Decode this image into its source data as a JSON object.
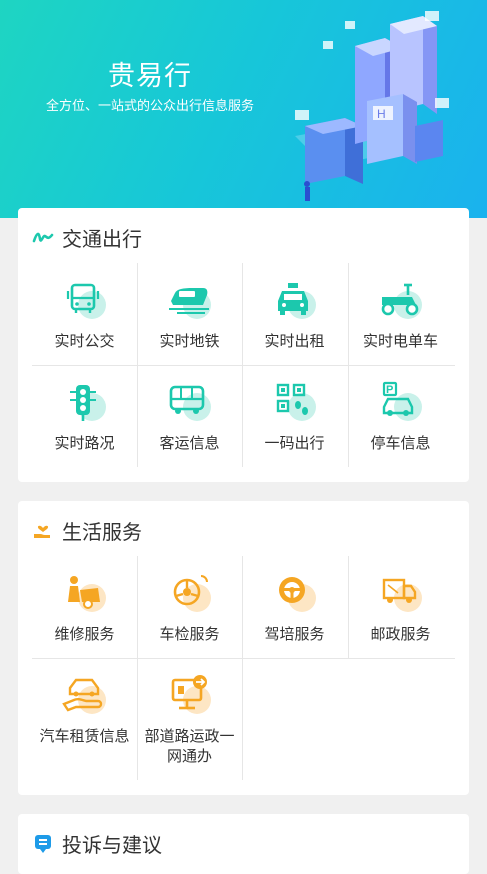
{
  "header": {
    "title": "贵易行",
    "subtitle": "全方位、一站式的公众出行信息服务"
  },
  "colors": {
    "teal": "#1cc8ad",
    "orange": "#f5a623",
    "blue": "#1e9be8"
  },
  "sections": {
    "traffic": {
      "title": "交通出行",
      "icon": "wave-icon",
      "items": [
        {
          "label": "实时公交",
          "icon": "bus-icon"
        },
        {
          "label": "实时地铁",
          "icon": "metro-icon"
        },
        {
          "label": "实时出租",
          "icon": "taxi-icon"
        },
        {
          "label": "实时电单车",
          "icon": "scooter-icon"
        },
        {
          "label": "实时路况",
          "icon": "traffic-light-icon"
        },
        {
          "label": "客运信息",
          "icon": "coach-icon"
        },
        {
          "label": "一码出行",
          "icon": "qr-code-icon"
        },
        {
          "label": "停车信息",
          "icon": "parking-icon"
        }
      ]
    },
    "life": {
      "title": "生活服务",
      "icon": "hand-heart-icon",
      "items": [
        {
          "label": "维修服务",
          "icon": "repair-icon"
        },
        {
          "label": "车检服务",
          "icon": "inspection-icon"
        },
        {
          "label": "驾培服务",
          "icon": "steering-wheel-icon"
        },
        {
          "label": "邮政服务",
          "icon": "delivery-truck-icon"
        },
        {
          "label": "汽车租赁信息",
          "icon": "car-rental-icon"
        },
        {
          "label": "部道路运政一网通办",
          "label_line1": "部道路运政一",
          "label_line2": "网通办",
          "icon": "monitor-icon"
        }
      ]
    },
    "complaint": {
      "title": "投诉与建议",
      "icon": "complaint-icon"
    }
  }
}
